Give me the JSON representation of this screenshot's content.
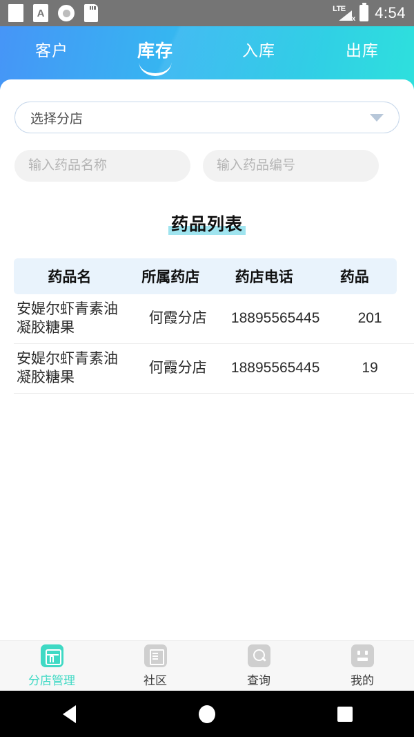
{
  "statusbar": {
    "network_label": "LTE",
    "time": "4:54",
    "icons": [
      "blank-page-icon",
      "font-size-a-icon",
      "record-circle-icon",
      "sd-card-icon",
      "signal-icon",
      "battery-icon"
    ]
  },
  "header": {
    "tabs": [
      {
        "label": "客户",
        "active": false
      },
      {
        "label": "库存",
        "active": true
      },
      {
        "label": "入库",
        "active": false
      },
      {
        "label": "出库",
        "active": false
      }
    ]
  },
  "filters": {
    "branch_select": {
      "label": "选择分店",
      "value": ""
    },
    "drug_name_input": {
      "value": "",
      "placeholder": "输入药品名称"
    },
    "drug_code_input": {
      "value": "",
      "placeholder": "输入药品编号"
    }
  },
  "section": {
    "title": "药品列表"
  },
  "table": {
    "columns": [
      "药品名",
      "所属药店",
      "药店电话",
      "药品"
    ],
    "rows": [
      {
        "name": "安媞尔虾青素油凝胶糖果",
        "store": "何霞分店",
        "phone": "18895565445",
        "code": "201"
      },
      {
        "name": "安媞尔虾青素油凝胶糖果",
        "store": "何霞分店",
        "phone": "18895565445",
        "code": "19"
      }
    ]
  },
  "bottomnav": {
    "items": [
      {
        "label": "分店管理",
        "icon": "store-icon",
        "active": true
      },
      {
        "label": "社区",
        "icon": "document-icon",
        "active": false
      },
      {
        "label": "查询",
        "icon": "search-icon",
        "active": false
      },
      {
        "label": "我的",
        "icon": "profile-face-icon",
        "active": false
      }
    ]
  },
  "androidnav": {
    "back": "back-icon",
    "home": "home-icon",
    "recents": "recents-icon"
  },
  "colors": {
    "gradient_start": "#4695f7",
    "gradient_end": "#2ee0dd",
    "accent_teal": "#3fd9c4",
    "highlight": "#9fe4ef",
    "table_header_bg": "#e9f3fc"
  }
}
